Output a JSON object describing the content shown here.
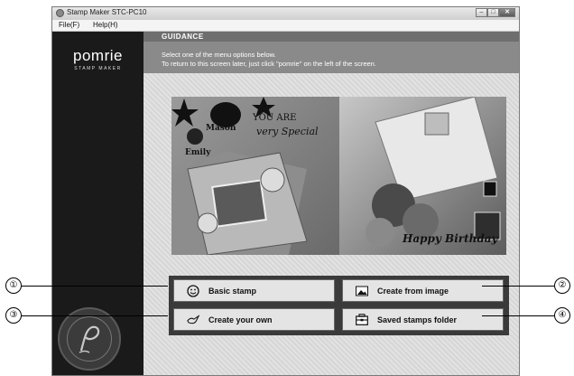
{
  "window": {
    "title": "Stamp Maker STC-PC10",
    "controls": [
      "–",
      "□",
      "✕"
    ]
  },
  "menubar": {
    "items": [
      "File(F)",
      "Help(H)"
    ]
  },
  "sidebar": {
    "logo": "pomrie",
    "logo_sub": "STAMP MAKER"
  },
  "guidance": {
    "title": "GUIDANCE",
    "line1": "Select one of the menu options below.",
    "line2": "To return to this screen later, just click \"pomrie\" on the left of the screen."
  },
  "photo": {
    "name1": "Mason",
    "name2": "Emily",
    "text1": "YOU ARE",
    "text2": "very Special",
    "text3": "Happy Birthday"
  },
  "menu": {
    "basic": "Basic stamp",
    "from_image": "Create from image",
    "own": "Create your own",
    "saved": "Saved stamps folder"
  },
  "callouts": [
    "①",
    "②",
    "③",
    "④"
  ],
  "icons": {
    "basic": "smiley-icon",
    "from_image": "image-icon",
    "own": "bird-icon",
    "saved": "folder-icon"
  }
}
